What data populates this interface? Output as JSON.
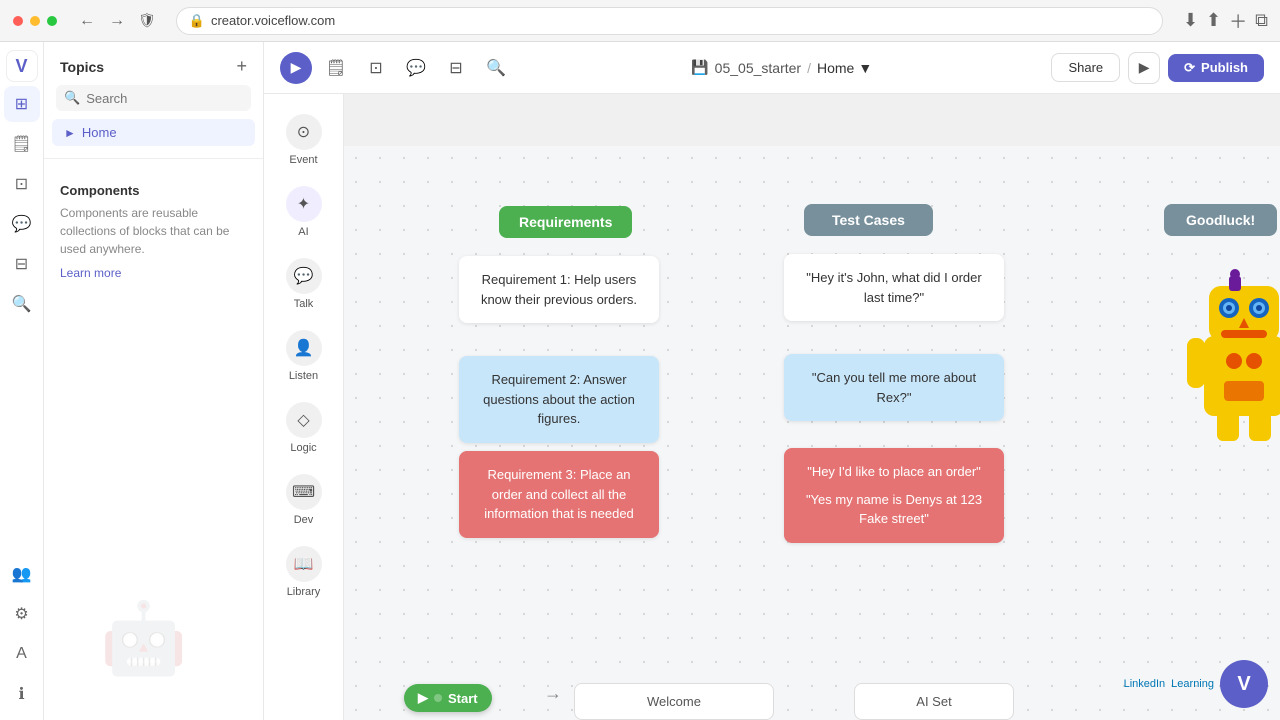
{
  "browser": {
    "url": "creator.voiceflow.com",
    "back_disabled": false,
    "forward_disabled": false
  },
  "topbar": {
    "project_name": "05_05_starter",
    "current_page": "Home",
    "share_label": "Share",
    "publish_label": "Publish"
  },
  "sidebar": {
    "topics_label": "Topics",
    "search_placeholder": "Search",
    "home_item": "Home",
    "components_label": "Components",
    "components_desc": "Components are reusable collections of blocks that can be used anywhere.",
    "learn_more": "Learn more"
  },
  "blocks": [
    {
      "id": "event",
      "label": "Event",
      "icon": "⊙"
    },
    {
      "id": "ai",
      "label": "AI",
      "icon": "✦"
    },
    {
      "id": "talk",
      "label": "Talk",
      "icon": "◉"
    },
    {
      "id": "listen",
      "label": "Listen",
      "icon": "👤"
    },
    {
      "id": "logic",
      "label": "Logic",
      "icon": "◇"
    },
    {
      "id": "dev",
      "label": "Dev",
      "icon": "⌨"
    },
    {
      "id": "library",
      "label": "Library",
      "icon": "📖"
    }
  ],
  "canvas": {
    "requirements_header": "Requirements",
    "req_card_1": "Requirement 1: Help users know their previous orders.",
    "req_card_2": "Requirement 2: Answer questions about the action figures.",
    "req_card_3": "Requirement 3: Place an order and collect all the information that is needed",
    "test_cases_header": "Test Cases",
    "tc_card_1": "\"Hey it's John, what did I order last time?\"",
    "tc_card_2": "\"Can you tell me more about Rex?\"",
    "tc_card_3_a": "\"Hey I'd like to place an order\"",
    "tc_card_3_b": "\"Yes my name is Denys at 123 Fake street\"",
    "goodluck_header": "Goodluck!",
    "start_label": "Start",
    "welcome_label": "Welcome",
    "ai_set_label": "AI Set"
  },
  "linkedin": {
    "text": "LinkedIn Learning"
  }
}
